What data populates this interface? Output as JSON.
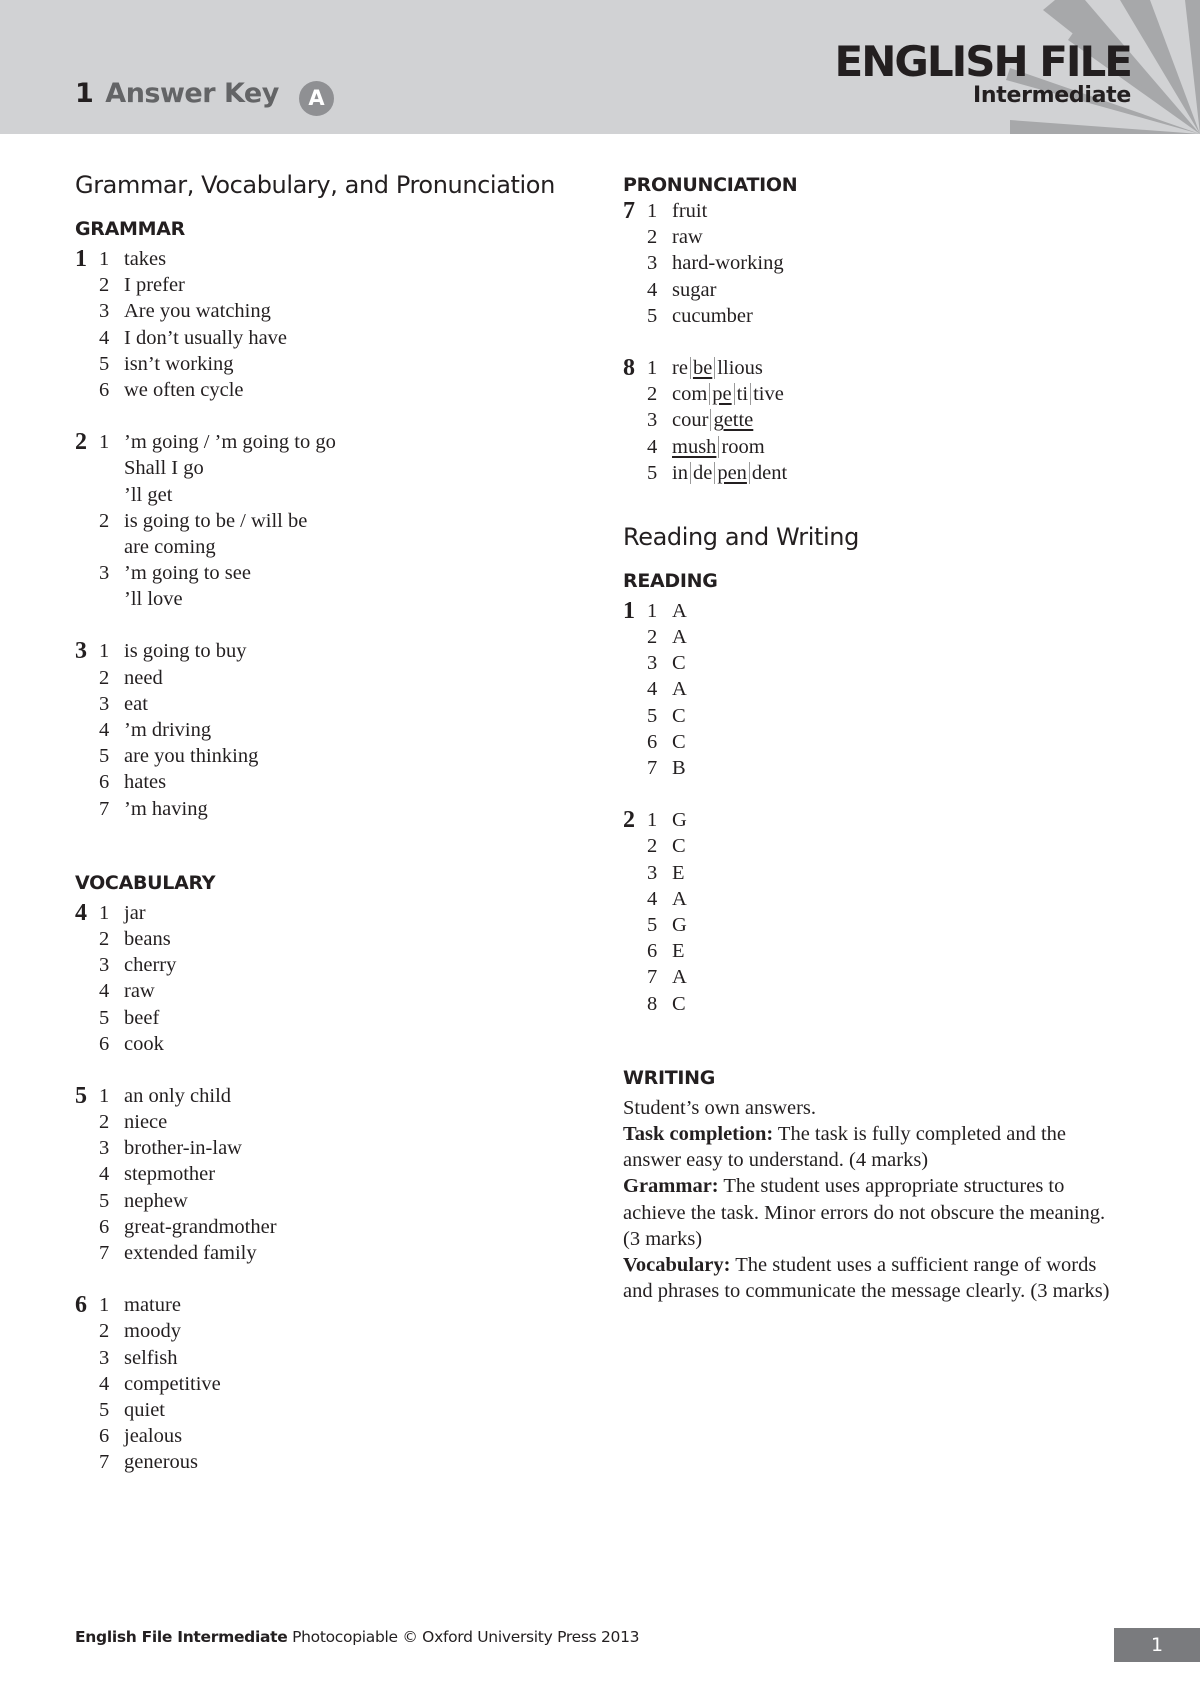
{
  "header": {
    "unit_number": "1",
    "title": "Answer Key",
    "version_badge": "A",
    "brand": "ENGLISH FILE",
    "level": "Intermediate"
  },
  "left": {
    "section_title": "Grammar, Vocabulary, and Pronunciation",
    "grammar_heading": "GRAMMAR",
    "vocabulary_heading": "VOCABULARY",
    "exercises": {
      "g1": {
        "number": "1",
        "items": [
          {
            "n": "1",
            "lines": [
              "takes"
            ]
          },
          {
            "n": "2",
            "lines": [
              "I prefer"
            ]
          },
          {
            "n": "3",
            "lines": [
              "Are you watching"
            ]
          },
          {
            "n": "4",
            "lines": [
              "I don’t usually have"
            ]
          },
          {
            "n": "5",
            "lines": [
              "isn’t working"
            ]
          },
          {
            "n": "6",
            "lines": [
              "we often cycle"
            ]
          }
        ]
      },
      "g2": {
        "number": "2",
        "items": [
          {
            "n": "1",
            "lines": [
              "’m going / ’m going to go",
              "Shall I go",
              "’ll get"
            ]
          },
          {
            "n": "2",
            "lines": [
              "is going to be / will be",
              "are coming"
            ]
          },
          {
            "n": "3",
            "lines": [
              "’m going to see",
              "’ll love"
            ]
          }
        ]
      },
      "g3": {
        "number": "3",
        "items": [
          {
            "n": "1",
            "lines": [
              "is going to buy"
            ]
          },
          {
            "n": "2",
            "lines": [
              "need"
            ]
          },
          {
            "n": "3",
            "lines": [
              "eat"
            ]
          },
          {
            "n": "4",
            "lines": [
              "’m driving"
            ]
          },
          {
            "n": "5",
            "lines": [
              "are you thinking"
            ]
          },
          {
            "n": "6",
            "lines": [
              "hates"
            ]
          },
          {
            "n": "7",
            "lines": [
              "’m having"
            ]
          }
        ]
      },
      "v4": {
        "number": "4",
        "items": [
          {
            "n": "1",
            "lines": [
              "jar"
            ]
          },
          {
            "n": "2",
            "lines": [
              "beans"
            ]
          },
          {
            "n": "3",
            "lines": [
              "cherry"
            ]
          },
          {
            "n": "4",
            "lines": [
              "raw"
            ]
          },
          {
            "n": "5",
            "lines": [
              "beef"
            ]
          },
          {
            "n": "6",
            "lines": [
              "cook"
            ]
          }
        ]
      },
      "v5": {
        "number": "5",
        "items": [
          {
            "n": "1",
            "lines": [
              "an only child"
            ]
          },
          {
            "n": "2",
            "lines": [
              "niece"
            ]
          },
          {
            "n": "3",
            "lines": [
              "brother-in-law"
            ]
          },
          {
            "n": "4",
            "lines": [
              "stepmother"
            ]
          },
          {
            "n": "5",
            "lines": [
              "nephew"
            ]
          },
          {
            "n": "6",
            "lines": [
              "great-grandmother"
            ]
          },
          {
            "n": "7",
            "lines": [
              "extended family"
            ]
          }
        ]
      },
      "v6": {
        "number": "6",
        "items": [
          {
            "n": "1",
            "lines": [
              "mature"
            ]
          },
          {
            "n": "2",
            "lines": [
              "moody"
            ]
          },
          {
            "n": "3",
            "lines": [
              "selfish"
            ]
          },
          {
            "n": "4",
            "lines": [
              "competitive"
            ]
          },
          {
            "n": "5",
            "lines": [
              "quiet"
            ]
          },
          {
            "n": "6",
            "lines": [
              "jealous"
            ]
          },
          {
            "n": "7",
            "lines": [
              "generous"
            ]
          }
        ]
      }
    }
  },
  "right": {
    "pronunciation_heading": "PRONUNCIATION",
    "p7": {
      "number": "7",
      "items": [
        {
          "n": "1",
          "lines": [
            "fruit"
          ]
        },
        {
          "n": "2",
          "lines": [
            "raw"
          ]
        },
        {
          "n": "3",
          "lines": [
            "hard-working"
          ]
        },
        {
          "n": "4",
          "lines": [
            "sugar"
          ]
        },
        {
          "n": "5",
          "lines": [
            "cucumber"
          ]
        }
      ]
    },
    "p8": {
      "number": "8",
      "items": [
        {
          "n": "1",
          "syllables": [
            "re",
            "be",
            "llious"
          ],
          "stressed": 1
        },
        {
          "n": "2",
          "syllables": [
            "com",
            "pe",
            "ti",
            "tive"
          ],
          "stressed": 1
        },
        {
          "n": "3",
          "syllables": [
            "cour",
            "gette"
          ],
          "stressed": 1
        },
        {
          "n": "4",
          "syllables": [
            "mush",
            "room"
          ],
          "stressed": 0
        },
        {
          "n": "5",
          "syllables": [
            "in",
            "de",
            "pen",
            "dent"
          ],
          "stressed": 2
        }
      ]
    },
    "section_title": "Reading and Writing",
    "reading_heading": "READING",
    "r1": {
      "number": "1",
      "items": [
        {
          "n": "1",
          "lines": [
            "A"
          ]
        },
        {
          "n": "2",
          "lines": [
            "A"
          ]
        },
        {
          "n": "3",
          "lines": [
            "C"
          ]
        },
        {
          "n": "4",
          "lines": [
            "A"
          ]
        },
        {
          "n": "5",
          "lines": [
            "C"
          ]
        },
        {
          "n": "6",
          "lines": [
            "C"
          ]
        },
        {
          "n": "7",
          "lines": [
            "B"
          ]
        }
      ]
    },
    "r2": {
      "number": "2",
      "items": [
        {
          "n": "1",
          "lines": [
            "G"
          ]
        },
        {
          "n": "2",
          "lines": [
            "C"
          ]
        },
        {
          "n": "3",
          "lines": [
            "E"
          ]
        },
        {
          "n": "4",
          "lines": [
            "A"
          ]
        },
        {
          "n": "5",
          "lines": [
            "G"
          ]
        },
        {
          "n": "6",
          "lines": [
            "E"
          ]
        },
        {
          "n": "7",
          "lines": [
            "A"
          ]
        },
        {
          "n": "8",
          "lines": [
            "C"
          ]
        }
      ]
    },
    "writing_heading": "WRITING",
    "writing": {
      "intro": "Student’s own answers.",
      "criteria": [
        {
          "label": "Task completion:",
          "text": " The task is fully completed and the answer easy to understand. (4 marks)"
        },
        {
          "label": "Grammar:",
          "text": " The student uses appropriate structures to achieve the task. Minor errors do not obscure the meaning. (3 marks)"
        },
        {
          "label": "Vocabulary:",
          "text": " The student uses a sufficient range of words and phrases to communicate the message clearly. (3 marks)"
        }
      ]
    }
  },
  "footer": {
    "book": "English File Intermediate",
    "rights": " Photocopiable © Oxford University Press 2013",
    "page_number": "1"
  },
  "colors": {
    "header_bg": "#d1d2d4",
    "rays": "#a7a8aa",
    "badge_bg": "#8f9093",
    "title_grey": "#636466",
    "page_box": "#7a7b7e",
    "text": "#231f20"
  }
}
